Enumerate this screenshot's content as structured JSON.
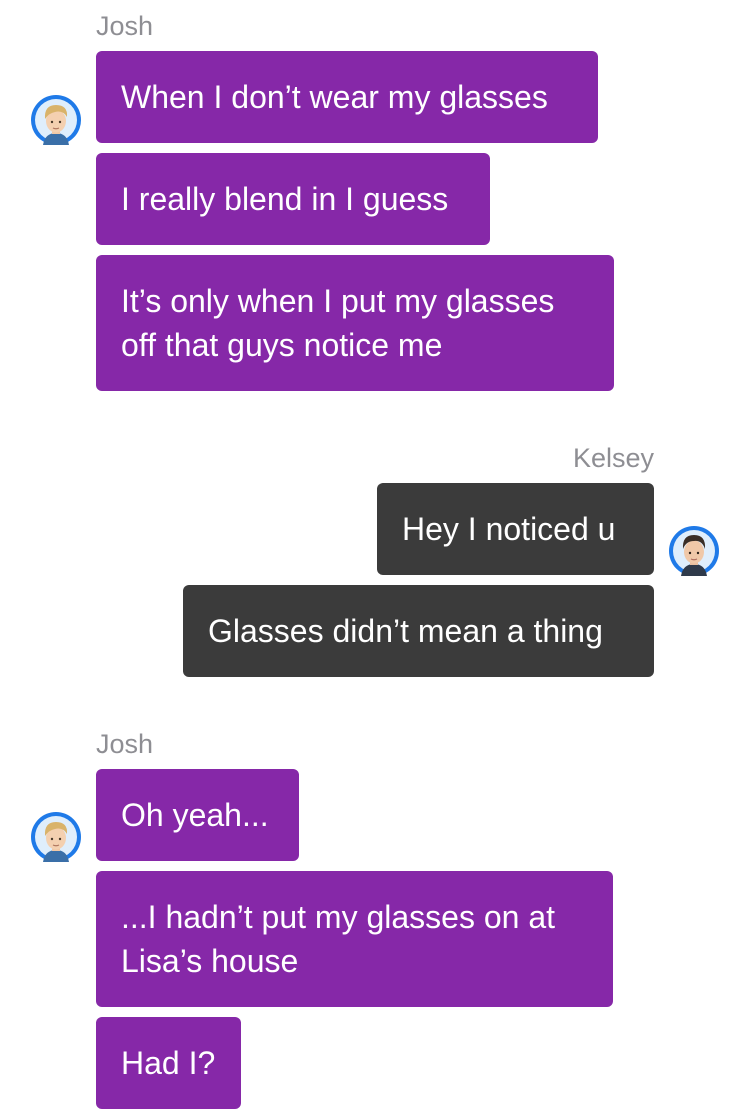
{
  "conversation": {
    "groups": [
      {
        "sender": "Josh",
        "avatar_icon": "blond-guy-avatar-icon",
        "messages": [
          {
            "text": "When I don’t wear my glasses"
          },
          {
            "text": "I really blend in I guess"
          },
          {
            "lines": [
              "It’s only when I put my glasses",
              "off that guys notice me"
            ]
          }
        ]
      },
      {
        "sender": "Kelsey",
        "avatar_icon": "dark-hair-guy-avatar-icon",
        "messages": [
          {
            "text": "Hey I noticed u"
          },
          {
            "text": "Glasses didn’t mean a thing"
          }
        ]
      },
      {
        "sender": "Josh",
        "avatar_icon": "blond-guy-avatar-icon",
        "messages": [
          {
            "text": "Oh yeah..."
          },
          {
            "lines": [
              "...I hadn’t put my glasses on at",
              "Lisa’s house"
            ]
          },
          {
            "text": "Had I?"
          }
        ]
      }
    ]
  },
  "colors": {
    "incoming_bubble": "#8628a8",
    "outgoing_bubble": "#3b3b3b",
    "bubble_text": "#ffffff",
    "sender_name": "#8e8e93",
    "avatar_ring": "#1f7ae8"
  }
}
